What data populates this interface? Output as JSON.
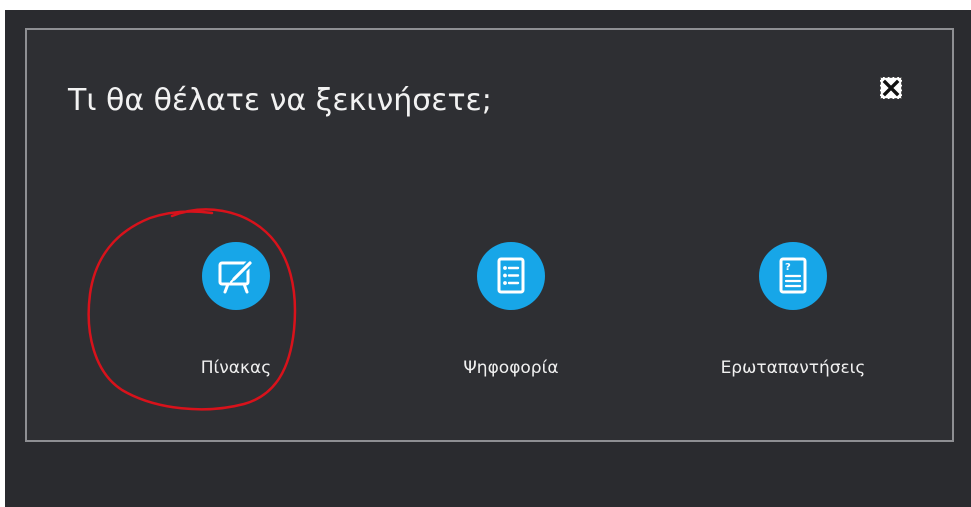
{
  "dialog": {
    "title": "Τι θα θέλατε να ξεκινήσετε;",
    "close_icon": "close-icon"
  },
  "options": [
    {
      "label": "Πίνακας",
      "icon": "whiteboard-icon"
    },
    {
      "label": "Ψηφοφορία",
      "icon": "poll-list-icon"
    },
    {
      "label": "Ερωταπαντήσεις",
      "icon": "qa-document-icon"
    }
  ],
  "colors": {
    "backdrop": "#2a2b2f",
    "dialog_bg": "#2e2f33",
    "dialog_border": "#8e8f93",
    "icon_accent": "#17a6e8",
    "annotation": "#d8121b"
  }
}
